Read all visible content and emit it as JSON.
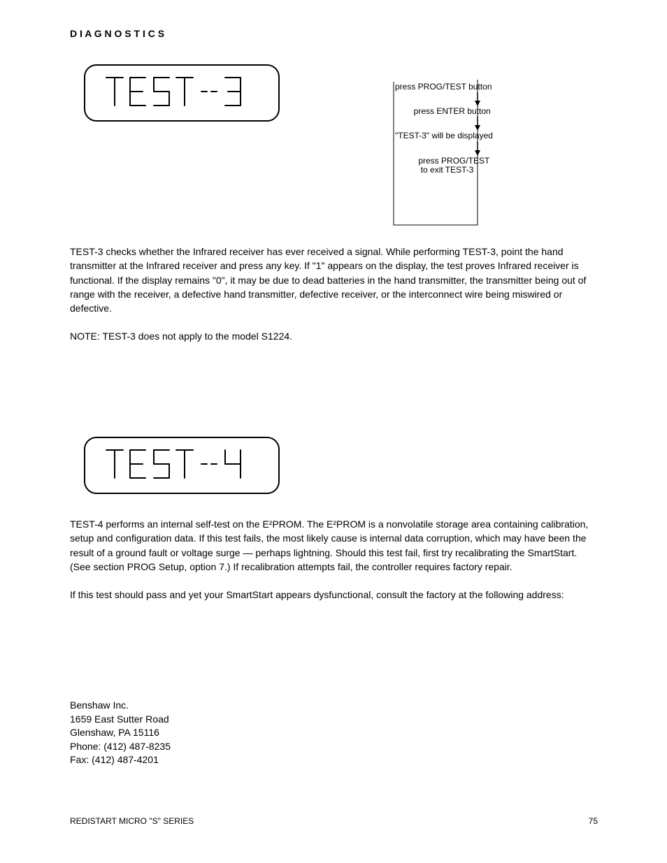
{
  "header": "D  I  A  G  N  O  S  T  I  C  S",
  "lcd1_name": "TEST-3",
  "lcd2_name": "TEST-4",
  "flow": {
    "n1": "press PROG/TEST button",
    "n2": "        press ENTER button",
    "n3": "\"TEST-3\" will be displayed",
    "n4": "          press PROG/TEST",
    "n5": "           to exit TEST-3"
  },
  "t3": {
    "p1": "TEST-3 checks whether the Infrared receiver has ever received a signal. While performing TEST-3, point the hand transmitter at the Infrared receiver and press any key. If \"1\" appears on the display, the test proves Infrared receiver is functional. If the display remains \"0\", it may be due to dead batteries in the hand transmitter, the transmitter being out of range with the receiver, a defective hand transmitter, defective receiver, or the interconnect wire being miswired or defective.",
    "note": "NOTE: TEST-3 does not apply to the model S1224."
  },
  "t4": {
    "p1": "TEST-4 performs an internal self-test on the E²PROM. The E²PROM is a nonvolatile storage area containing calibration, setup and configuration data. If this test fails, the most likely cause is internal data corruption, which may have been the result of a ground fault or voltage surge — perhaps lightning. Should this test fail, first try recalibrating the SmartStart. (See section PROG Setup, option 7.) If recalibration attempts fail, the controller requires factory repair.",
    "p2": "If this test should pass and yet your SmartStart appears dysfunctional, consult the factory at the following address:"
  },
  "sig": {
    "l1": "Benshaw Inc.",
    "l2": "1659 East Sutter Road",
    "l3": "Glenshaw, PA 15116",
    "l4": "Phone: (412) 487-8235",
    "l5": "Fax: (412) 487-4201"
  },
  "footer": {
    "left": "REDISTART MICRO \"S\" SERIES",
    "right": "75"
  }
}
